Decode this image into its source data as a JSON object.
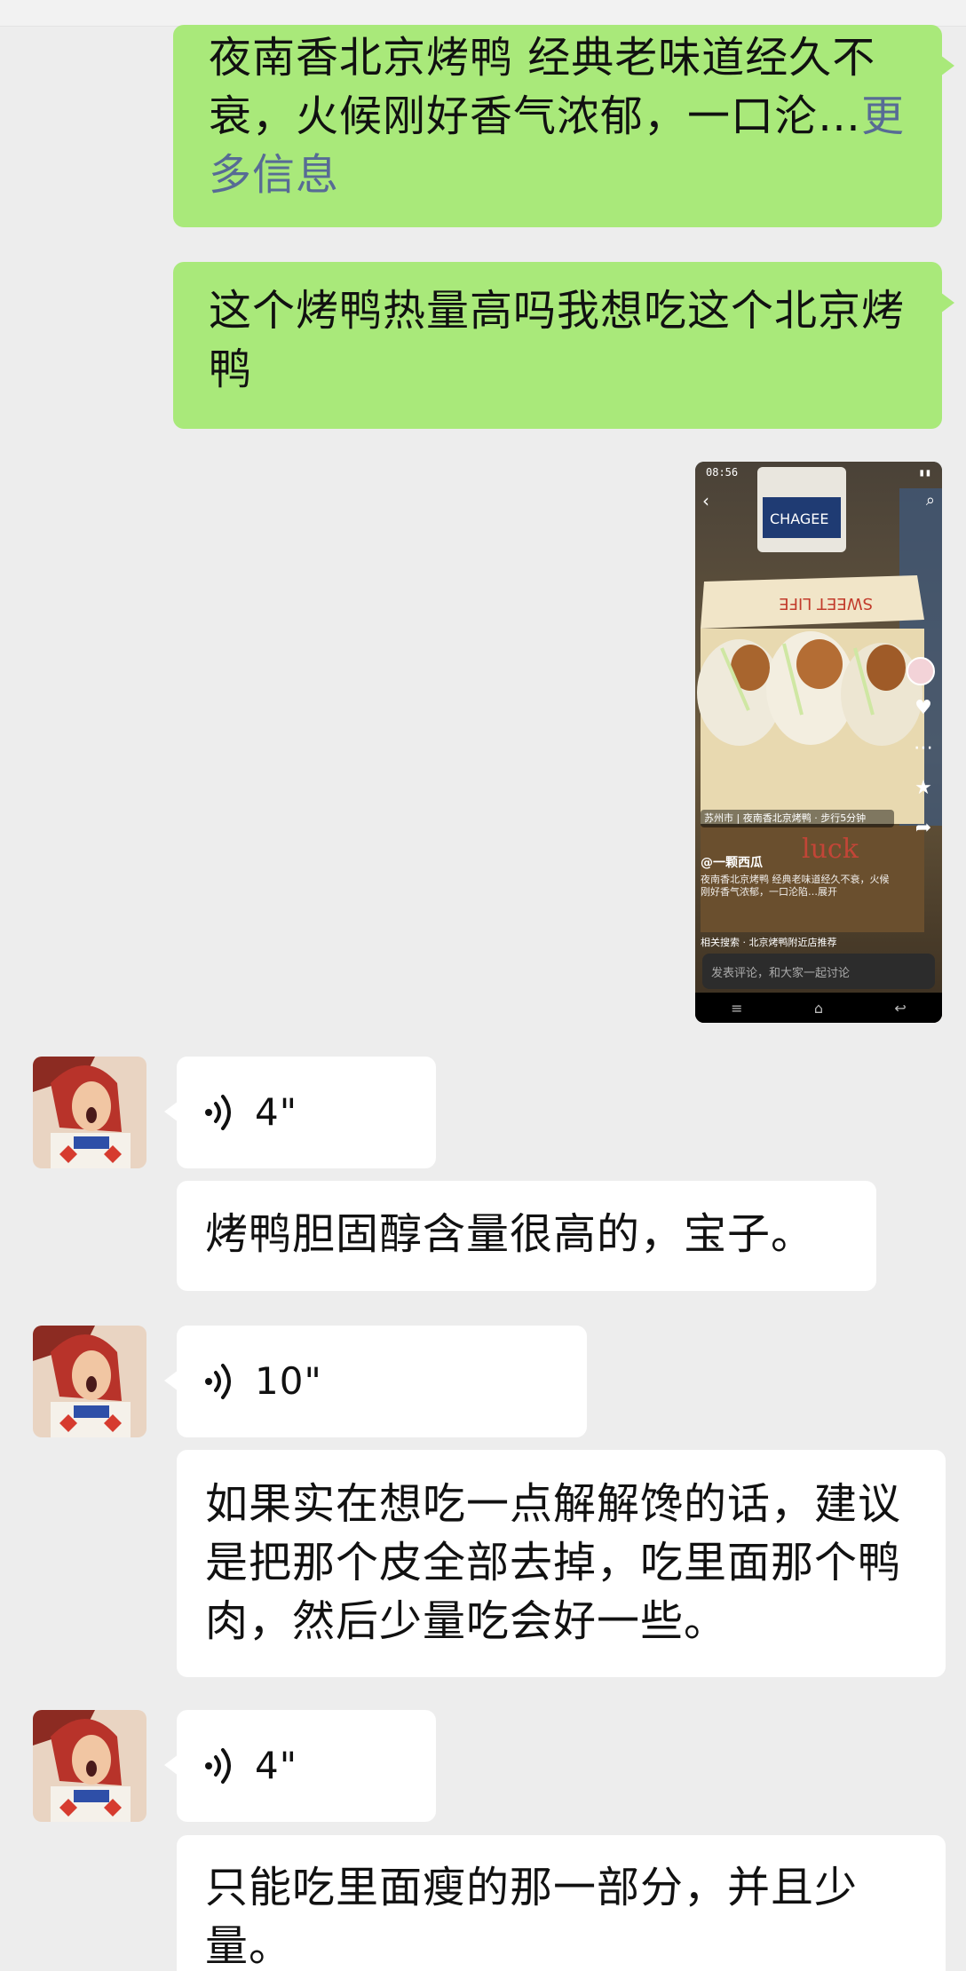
{
  "messages": {
    "m1": {
      "text": "夜南香北京烤鸭 经典老味道经久不衰，火候刚好香气浓郁，一口沦…",
      "more": "更多信息"
    },
    "m2": {
      "text": "这个烤鸭热量高吗我想吃这个北京烤鸭"
    },
    "v1": {
      "duration": "4\""
    },
    "t1": {
      "text": "烤鸭胆固醇含量很高的，宝子。"
    },
    "v2": {
      "duration": "10\""
    },
    "t2": {
      "text": "如果实在想吃一点解解馋的话，建议是把那个皮全部去掉，吃里面那个鸭肉，然后少量吃会好一些。"
    },
    "v3": {
      "duration": "4\""
    },
    "t3": {
      "text": "只能吃里面瘦的那一部分，并且少量。"
    }
  },
  "screenshot": {
    "status_time": "08:56",
    "location": "苏州市 | 夜南香北京烤鸭 · 步行5分钟",
    "author": "@一颗西瓜",
    "caption": "夜南香北京烤鸭 经典老味道经久不衰，火候刚好香气浓郁，一口沦陷…展开",
    "search_hint": "相关搜索 · 北京烤鸭附近店推荐",
    "comment_placeholder": "发表评论，和大家一起讨论"
  },
  "colors": {
    "sent_bubble": "#a9e97a",
    "received_bubble": "#ffffff",
    "background": "#ededed",
    "link": "#576b95"
  }
}
